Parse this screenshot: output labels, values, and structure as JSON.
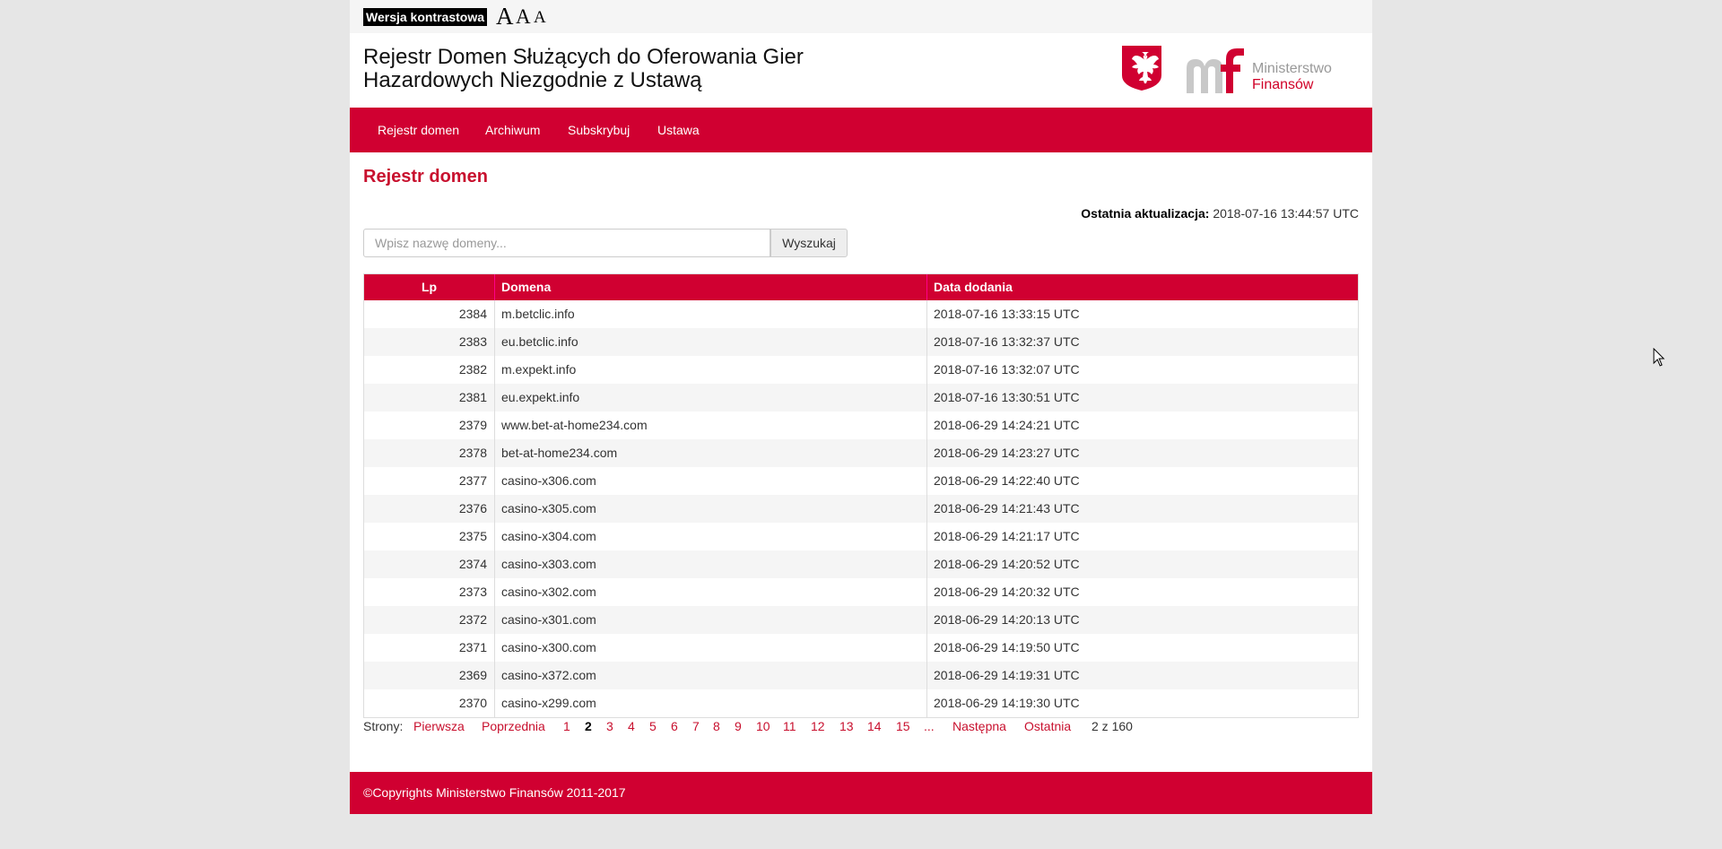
{
  "accessibility": {
    "contrast_label": "Wersja kontrastowa",
    "font_sizes": [
      "A",
      "A",
      "A"
    ]
  },
  "header": {
    "title_line1": "Rejestr Domen Służących do Oferowania Gier",
    "title_line2": "Hazardowych Niezgodnie z Ustawą",
    "ministry_line1": "Ministerstwo",
    "ministry_line2": "Finansów"
  },
  "nav": {
    "items": [
      "Rejestr domen",
      "Archiwum",
      "Subskrybuj",
      "Ustawa"
    ]
  },
  "main": {
    "title": "Rejestr domen",
    "last_update_label": "Ostatnia aktualizacja:",
    "last_update_value": "2018-07-16 13:44:57 UTC",
    "search": {
      "placeholder": "Wpisz nazwę domeny...",
      "button_label": "Wyszukaj"
    },
    "table": {
      "columns": [
        "Lp",
        "Domena",
        "Data dodania"
      ],
      "rows": [
        [
          "2384",
          "m.betclic.info",
          "2018-07-16 13:33:15 UTC"
        ],
        [
          "2383",
          "eu.betclic.info",
          "2018-07-16 13:32:37 UTC"
        ],
        [
          "2382",
          "m.expekt.info",
          "2018-07-16 13:32:07 UTC"
        ],
        [
          "2381",
          "eu.expekt.info",
          "2018-07-16 13:30:51 UTC"
        ],
        [
          "2379",
          "www.bet-at-home234.com",
          "2018-06-29 14:24:21 UTC"
        ],
        [
          "2378",
          "bet-at-home234.com",
          "2018-06-29 14:23:27 UTC"
        ],
        [
          "2377",
          "casino-x306.com",
          "2018-06-29 14:22:40 UTC"
        ],
        [
          "2376",
          "casino-x305.com",
          "2018-06-29 14:21:43 UTC"
        ],
        [
          "2375",
          "casino-x304.com",
          "2018-06-29 14:21:17 UTC"
        ],
        [
          "2374",
          "casino-x303.com",
          "2018-06-29 14:20:52 UTC"
        ],
        [
          "2373",
          "casino-x302.com",
          "2018-06-29 14:20:32 UTC"
        ],
        [
          "2372",
          "casino-x301.com",
          "2018-06-29 14:20:13 UTC"
        ],
        [
          "2371",
          "casino-x300.com",
          "2018-06-29 14:19:50 UTC"
        ],
        [
          "2369",
          "casino-x372.com",
          "2018-06-29 14:19:31 UTC"
        ],
        [
          "2370",
          "casino-x299.com",
          "2018-06-29 14:19:30 UTC"
        ]
      ]
    },
    "pager": {
      "label": "Strony:",
      "first": "Pierwsza",
      "prev": "Poprzednia",
      "pages": [
        "1",
        "2",
        "3",
        "4",
        "5",
        "6",
        "7",
        "8",
        "9",
        "10",
        "11",
        "12",
        "13",
        "14",
        "15",
        "..."
      ],
      "current": "2",
      "next": "Następna",
      "last": "Ostatnia",
      "summary": "2 z 160"
    }
  },
  "footer": {
    "text": "©Copyrights Ministerstwo Finansów 2011-2017"
  },
  "colors": {
    "brand_red": "#d00031",
    "title_red": "#c8102e"
  }
}
